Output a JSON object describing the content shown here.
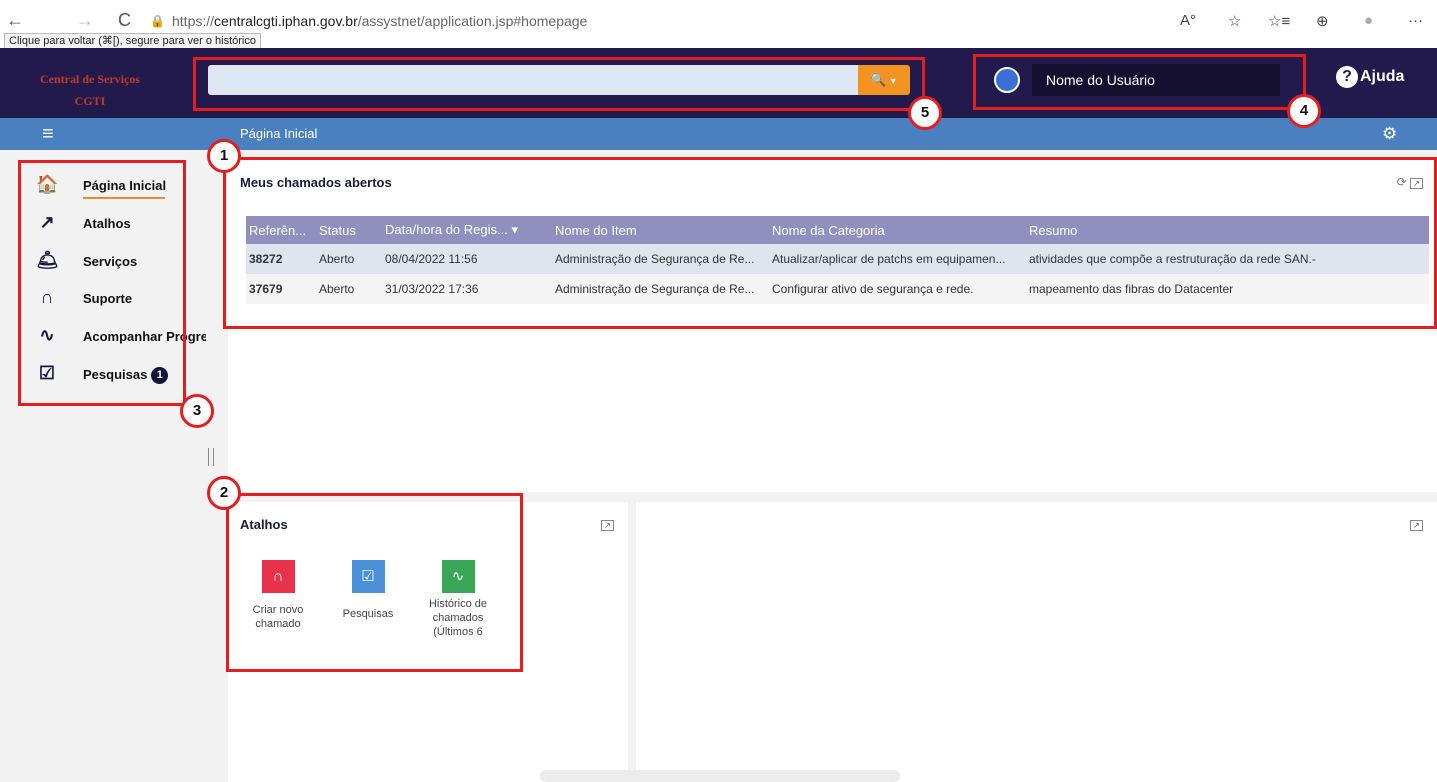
{
  "browser": {
    "back_icon": "←",
    "forward_icon": "→",
    "reload_icon": "C",
    "lock_icon": "🔒",
    "url_prefix": "https://",
    "url_domain": "centralcgti.iphan.gov.br",
    "url_path": "/assystnet/application.jsp#homepage",
    "tooltip": "Clique para voltar (⌘[), segure para ver o histórico",
    "read_aloud_icon": "A°",
    "favorite_icon": "☆",
    "favorites_icon": "☆≡",
    "collections_icon": "⊕",
    "profile_icon": "●",
    "more_icon": "···"
  },
  "header": {
    "brand_line1": "Central de Serviços",
    "brand_line2": "CGTI",
    "search_value": "",
    "search_icon": "🔍",
    "search_caret": "▾",
    "user_name": "Nome do Usuário",
    "help_label": "Ajuda",
    "help_icon": "?"
  },
  "subbar": {
    "menu_icon": "≡",
    "title": "Página Inicial",
    "settings_icon": "⚙"
  },
  "sidebar": {
    "items": [
      {
        "label": "Página Inicial",
        "icon": "🏠"
      },
      {
        "label": "Atalhos",
        "icon": "↗"
      },
      {
        "label": "Serviços",
        "icon": "🛎"
      },
      {
        "label": "Suporte",
        "icon": "∩"
      },
      {
        "label": "Acompanhar Progre",
        "icon": "∿"
      },
      {
        "label": "Pesquisas",
        "icon": "☑",
        "badge": "1"
      }
    ]
  },
  "open_tickets": {
    "title": "Meus chamados abertos",
    "refresh_icon": "⟳",
    "columns": [
      "Referên...",
      "Status",
      "Data/hora do Regis... ▾",
      "Nome do Item",
      "Nome da Categoria",
      "Resumo"
    ],
    "rows": [
      [
        "38272",
        "Aberto",
        "08/04/2022 11:56",
        "Administração de Segurança de Re...",
        "Atualizar/aplicar de patchs em equipamen...",
        "atividades que compõe a restruturação da rede SAN.-"
      ],
      [
        "37679",
        "Aberto",
        "31/03/2022 17:36",
        "Administração de Segurança de Re...",
        "Configurar ativo de segurança e rede.",
        "mapeamento das fibras do Datacenter"
      ]
    ]
  },
  "shortcuts": {
    "title": "Atalhos",
    "items": [
      {
        "label": "Criar novo chamado",
        "icon": "∩",
        "color": "#e8324a"
      },
      {
        "label": "Pesquisas",
        "icon": "☑",
        "color": "#4a90d9"
      },
      {
        "label": "Histórico de chamados (Últimos 6",
        "icon": "∿",
        "color": "#3aa657"
      }
    ]
  },
  "callouts": [
    "1",
    "2",
    "3",
    "4",
    "5"
  ],
  "colors": {
    "header_bg": "#221a4d",
    "subbar_bg": "#4a80c0",
    "search_button": "#f39321",
    "callout_red": "#e31e1e",
    "active_underline": "#e98a2c"
  }
}
